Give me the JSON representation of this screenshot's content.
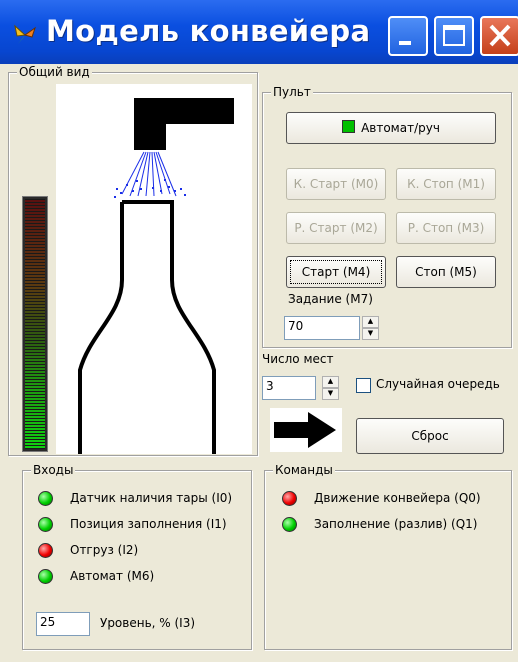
{
  "window": {
    "title": "Модель конвейера",
    "icon": "butterfly-app-icon"
  },
  "overview": {
    "label": "Общий вид",
    "level_percent": 25
  },
  "console": {
    "label": "Пульт",
    "auto_manual": {
      "label": "Автомат/руч",
      "indicator_color": "#00c000"
    },
    "k_start": "К. Старт (M0)",
    "k_stop": "К. Стоп (M1)",
    "r_start": "Р. Старт (M2)",
    "r_stop": "Р. Стоп (M3)",
    "start": "Старт (M4)",
    "stop": "Стоп (M5)",
    "task_label": "Задание (M7)",
    "task_value": "70"
  },
  "places": {
    "label": "Число мест",
    "value": "3",
    "random_queue_label": "Случайная очередь",
    "random_queue_checked": false,
    "reset": "Сброс"
  },
  "inputs": {
    "label": "Входы",
    "items": [
      {
        "label": "Датчик наличия тары (I0)",
        "state": "green"
      },
      {
        "label": "Позиция заполнения (I1)",
        "state": "green"
      },
      {
        "label": "Отгруз (I2)",
        "state": "red"
      },
      {
        "label": "Автомат (M6)",
        "state": "green"
      }
    ],
    "level_value": "25",
    "level_label": "Уровень, % (I3)"
  },
  "commands": {
    "label": "Команды",
    "items": [
      {
        "label": "Движение конвейера (Q0)",
        "state": "red"
      },
      {
        "label": "Заполнение (разлив) (Q1)",
        "state": "green"
      }
    ]
  },
  "colors": {
    "green": "#00d000",
    "red": "#f00000",
    "stream": "#1a2ee8"
  }
}
